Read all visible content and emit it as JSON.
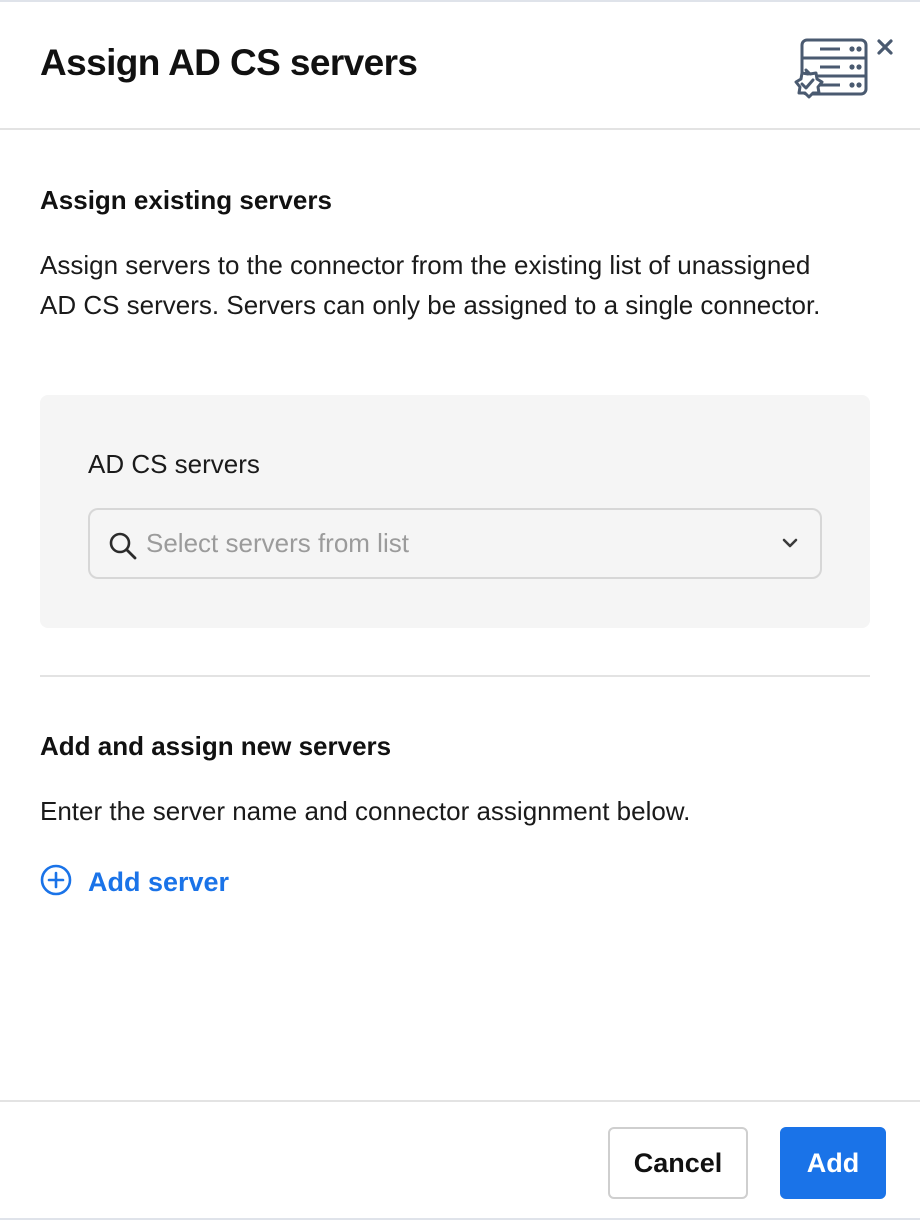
{
  "dialog": {
    "title": "Assign AD CS servers",
    "header_icon": "server-certificate-icon",
    "close_icon": "close-icon"
  },
  "existing": {
    "title": "Assign existing servers",
    "description": "Assign servers to the connector from the existing list of unassigned AD CS servers. Servers can only be assigned to a single connector.",
    "field_label": "AD CS servers",
    "select_placeholder": "Select servers from list",
    "search_icon": "search-icon",
    "dropdown_icon": "chevron-down-icon"
  },
  "new_servers": {
    "title": "Add and assign new servers",
    "description": "Enter the server name and connector assignment below.",
    "add_label": "Add server",
    "add_icon": "plus-circle-icon"
  },
  "footer": {
    "cancel_label": "Cancel",
    "add_label": "Add"
  },
  "colors": {
    "accent": "#1a73e8",
    "panel_bg": "#f5f5f5",
    "icon_stroke": "#4a5a70"
  }
}
